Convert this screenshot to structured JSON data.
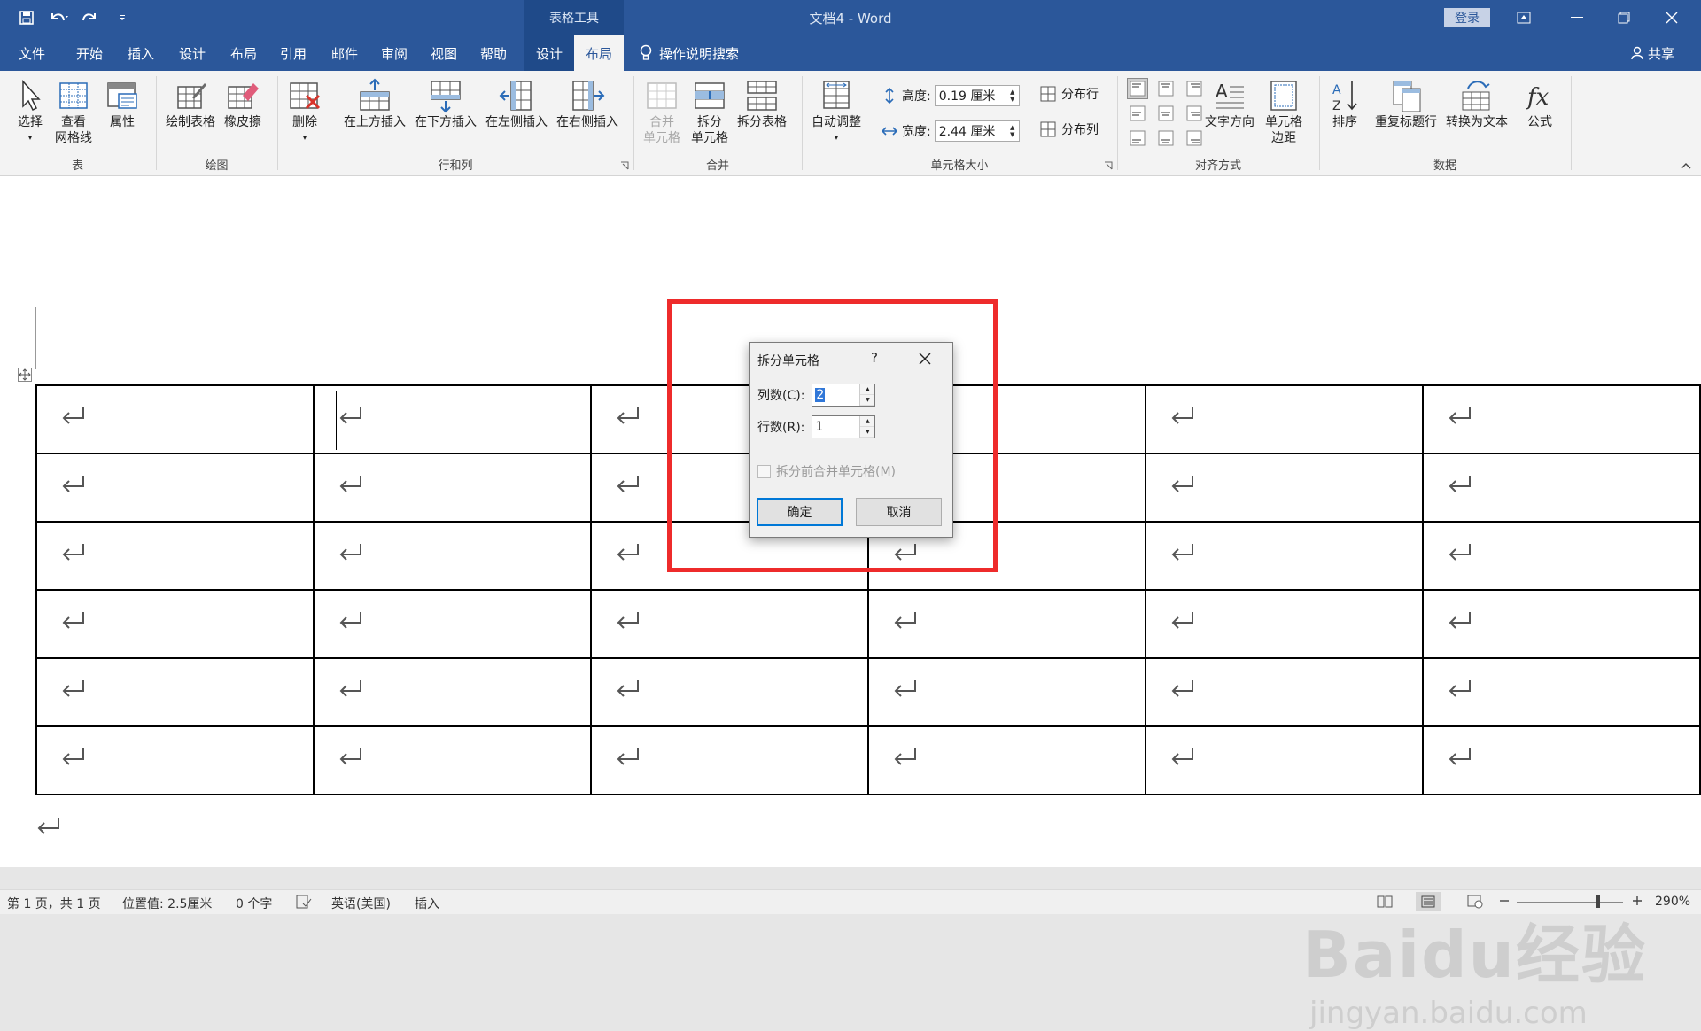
{
  "titlebar": {
    "doc_title": "文档4 - Word",
    "context_header": "表格工具",
    "login": "登录"
  },
  "tabs": [
    {
      "label": "文件"
    },
    {
      "label": "开始"
    },
    {
      "label": "插入"
    },
    {
      "label": "设计"
    },
    {
      "label": "布局"
    },
    {
      "label": "引用"
    },
    {
      "label": "邮件"
    },
    {
      "label": "审阅"
    },
    {
      "label": "视图"
    },
    {
      "label": "帮助"
    },
    {
      "label": "设计"
    },
    {
      "label": "布局"
    }
  ],
  "tell_me": "操作说明搜索",
  "share": "共享",
  "ribbon": {
    "groups": {
      "table": {
        "label": "表",
        "select": "选择",
        "gridlines": "查看\n网格线",
        "properties": "属性"
      },
      "draw": {
        "label": "绘图",
        "draw_table": "绘制表格",
        "eraser": "橡皮擦"
      },
      "rows_cols": {
        "label": "行和列",
        "delete": "删除",
        "insert_above": "在上方插入",
        "insert_below": "在下方插入",
        "insert_left": "在左侧插入",
        "insert_right": "在右侧插入"
      },
      "merge": {
        "label": "合并",
        "merge_cells": "合并\n单元格",
        "split_cells": "拆分\n单元格",
        "split_table": "拆分表格"
      },
      "cell_size": {
        "label": "单元格大小",
        "autofit": "自动调整",
        "height_label": "高度:",
        "height_value": "0.19 厘米",
        "width_label": "宽度:",
        "width_value": "2.44 厘米",
        "dist_rows": "分布行",
        "dist_cols": "分布列"
      },
      "alignment": {
        "label": "对齐方式",
        "text_direction": "文字方向",
        "cell_margins": "单元格\n边距"
      },
      "data": {
        "label": "数据",
        "sort": "排序",
        "repeat_header": "重复标题行",
        "convert_text": "转换为文本",
        "formula": "公式"
      }
    }
  },
  "dialog": {
    "title": "拆分单元格",
    "help": "?",
    "cols_label": "列数(C):",
    "cols_value": "2",
    "rows_label": "行数(R):",
    "rows_value": "1",
    "merge_before_label": "拆分前合并单元格(M)",
    "ok": "确定",
    "cancel": "取消"
  },
  "table": {
    "rows": 6,
    "cols": 6
  },
  "statusbar": {
    "page": "第 1 页，共 1 页",
    "position": "位置值: 2.5厘米",
    "words": "0 个字",
    "language": "英语(美国)",
    "mode": "插入",
    "zoom": "290%"
  },
  "watermark": {
    "line1": "Baidu经验",
    "line2": "jingyan.baidu.com"
  },
  "colors": {
    "word_blue": "#2b579a",
    "context_blue": "#1f4a89",
    "highlight_red": "#ee2b2b",
    "dialog_bg": "#f0f0f0"
  }
}
